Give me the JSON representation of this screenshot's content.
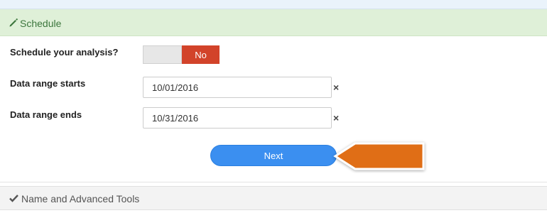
{
  "schedule_panel": {
    "title": "Schedule",
    "icon": "pencil-icon",
    "title_color": "#3c763d",
    "header_bg": "#dff0d8"
  },
  "form": {
    "schedule_label": "Schedule your analysis?",
    "schedule_toggle_value": "No",
    "toggle_color": "#d2432a",
    "start_label": "Data range starts",
    "start_value": "10/01/2016",
    "end_label": "Data range ends",
    "end_value": "10/31/2016",
    "clear_glyph": "×"
  },
  "actions": {
    "next_label": "Next",
    "next_color": "#3b8ff0",
    "callout_color": "#e06e12"
  },
  "advanced_panel": {
    "title": "Name and Advanced Tools",
    "icon": "check-icon"
  }
}
